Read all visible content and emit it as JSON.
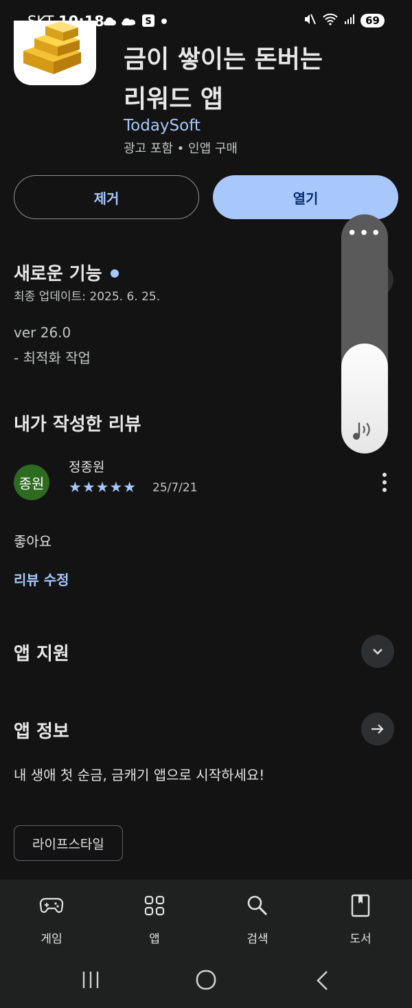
{
  "status_bar": {
    "carrier": "SKT",
    "time": "10:18",
    "extra_icons": [
      "cloud-icon",
      "weather-icon",
      "s-app-icon",
      "dot-icon"
    ],
    "battery": "69"
  },
  "app": {
    "title_line1": "금이 쌓이는 돈버는",
    "title_line2": "리워드 앱",
    "developer": "TodaySoft",
    "meta": "광고 포함 • 인앱 구매",
    "remove_label": "제거",
    "open_label": "열기"
  },
  "whats_new": {
    "heading": "새로운 기능",
    "updated": "최종 업데이트: 2025. 6. 25.",
    "version": "ver 26.0",
    "note": "- 최적화 작업"
  },
  "my_review": {
    "heading": "내가 작성한 리뷰",
    "avatar_text": "종원",
    "reviewer": "정종원",
    "rating": 5,
    "stars": "★★★★★",
    "date": "25/7/21",
    "text": "좋아요",
    "edit_label": "리뷰 수정"
  },
  "app_support": {
    "heading": "앱 지원"
  },
  "app_info": {
    "heading": "앱 정보",
    "description": "내 생애 첫 순금, 금캐기 앱으로 시작하세요!",
    "category_chip": "라이프스타일"
  },
  "bottom_nav": [
    {
      "label": "게임",
      "icon": "gamepad-icon"
    },
    {
      "label": "앱",
      "icon": "apps-grid-icon"
    },
    {
      "label": "검색",
      "icon": "search-icon"
    },
    {
      "label": "도서",
      "icon": "book-icon"
    }
  ],
  "volume_panel": {
    "level": 0.46,
    "icon": "media-volume-icon"
  },
  "colors": {
    "background": "#131314",
    "accent": "#a8c7fa",
    "avatar": "#2d6b1f"
  }
}
